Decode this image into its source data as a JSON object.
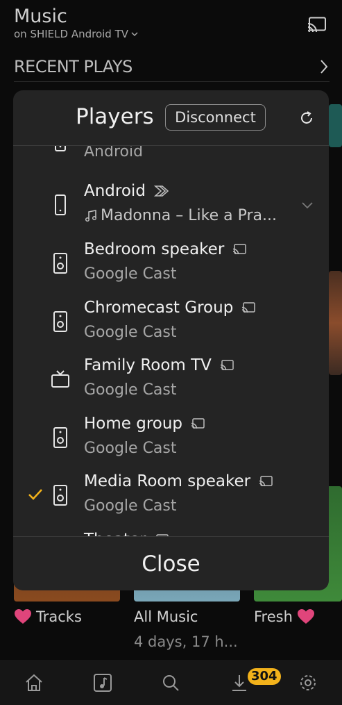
{
  "app": {
    "title": "Music",
    "subtitle": "on SHIELD Android TV",
    "section_title": "RECENT PLAYS"
  },
  "tiles": [
    {
      "label": "Tracks"
    },
    {
      "label": "All Music",
      "sub": "4 days, 17 h..."
    },
    {
      "label": "Fresh"
    }
  ],
  "nav": {
    "items": [
      "home-icon",
      "music-note-icon",
      "search-icon",
      "download-icon",
      "gear-icon"
    ],
    "download_badge": "304"
  },
  "dialog": {
    "title": "Players",
    "disconnect_label": "Disconnect",
    "close_label": "Close",
    "players": [
      {
        "name": "",
        "sub": "Android",
        "icon": "phone-icon"
      },
      {
        "name": "Android",
        "sub": "Madonna – Like a Pra...",
        "icon": "phone-icon",
        "now_playing": true
      },
      {
        "name": "Bedroom speaker",
        "sub": "Google Cast",
        "icon": "speaker-icon"
      },
      {
        "name": "Chromecast Group",
        "sub": "Google Cast",
        "icon": "speaker-icon"
      },
      {
        "name": "Family Room TV",
        "sub": "Google Cast",
        "icon": "tv-icon"
      },
      {
        "name": "Home group",
        "sub": "Google Cast",
        "icon": "speaker-icon"
      },
      {
        "name": "Media Room speaker",
        "sub": "Google Cast",
        "icon": "speaker-icon",
        "selected": true
      },
      {
        "name": "Theater",
        "sub": "",
        "icon": "speaker-icon"
      }
    ]
  },
  "colors": {
    "accent": "#f2b21b",
    "dialog_bg": "#242424",
    "heart": "#e0457b"
  }
}
